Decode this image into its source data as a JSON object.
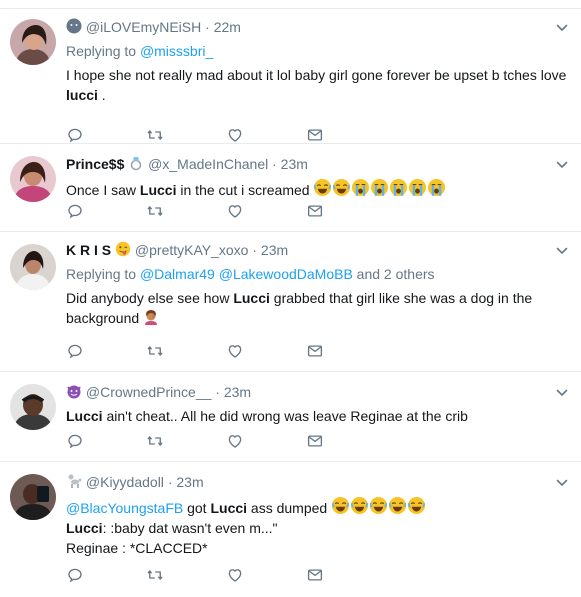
{
  "tweets": [
    {
      "fullname": "",
      "handle": "@iLOVEmyNEiSH",
      "time": "22m",
      "replying_label": "Replying to ",
      "replying_users": [
        "@misssbri_"
      ],
      "replying_extra": "",
      "text_1": "I hope she not really mad about it lol baby girl gone forever be upset b tches love",
      "text_bold": "lucci",
      "text_2": " ."
    },
    {
      "fullname": "Prince$$",
      "handle": "@x_MadeInChanel",
      "time": "23m",
      "text_1": "Once I saw ",
      "text_bold": "Lucci",
      "text_2": " in the cut i screamed"
    },
    {
      "fullname": "K R I S",
      "handle": "@prettyKAY_xoxo",
      "time": "23m",
      "replying_label": "Replying to ",
      "replying_users": [
        "@Dalmar49",
        "@LakewoodDaMoBB"
      ],
      "replying_extra": " and 2 others",
      "text_1": "Did anybody else see how ",
      "text_bold": "Lucci",
      "text_2": " grabbed that girl like she was a dog in the background"
    },
    {
      "fullname": "",
      "handle": "@CrownedPrince__",
      "time": "23m",
      "text_bold": "Lucci",
      "text_2": " ain't cheat.. All he did wrong was leave Reginae at the crib"
    },
    {
      "fullname": "",
      "handle": "@Kiyydadoll",
      "time": "23m",
      "mention": "@BlacYoungstaFB",
      "text_1": " got ",
      "text_bold": "Lucci",
      "text_2": " ass dumped",
      "line2_bold": "Lucci",
      "line2_rest": ": :baby dat wasn't even m...\"",
      "line3": "Reginae : *CLACCED*"
    }
  ],
  "icons": {
    "reply": "reply-icon",
    "retweet": "retweet-icon",
    "like": "heart-icon",
    "dm": "envelope-icon",
    "caret": "chevron-down-icon"
  },
  "colors": {
    "accent": "#1da1f2",
    "muted": "#657786",
    "text": "#14171a",
    "divider": "#e6ecf0"
  }
}
